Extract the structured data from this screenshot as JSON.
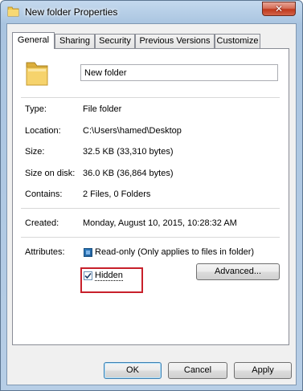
{
  "window": {
    "title": "New folder Properties",
    "close_glyph": "✕"
  },
  "tabs": [
    {
      "label": "General",
      "active": true
    },
    {
      "label": "Sharing",
      "active": false
    },
    {
      "label": "Security",
      "active": false
    },
    {
      "label": "Previous Versions",
      "active": false
    },
    {
      "label": "Customize",
      "active": false
    }
  ],
  "general": {
    "name_value": "New folder",
    "type_label": "Type:",
    "type_value": "File folder",
    "location_label": "Location:",
    "location_value": "C:\\Users\\hamed\\Desktop",
    "size_label": "Size:",
    "size_value": "32.5 KB (33,310 bytes)",
    "size_on_disk_label": "Size on disk:",
    "size_on_disk_value": "36.0 KB (36,864 bytes)",
    "contains_label": "Contains:",
    "contains_value": "2 Files, 0 Folders",
    "created_label": "Created:",
    "created_value": "Monday, August 10, 2015, 10:28:32 AM",
    "attributes_label": "Attributes:",
    "readonly_label": "Read-only (Only applies to files in folder)",
    "readonly_state": "indeterminate",
    "hidden_label": "Hidden",
    "hidden_checked": true,
    "advanced_label": "Advanced..."
  },
  "buttons": {
    "ok": "OK",
    "cancel": "Cancel",
    "apply": "Apply"
  },
  "colors": {
    "highlight": "#c8202b",
    "folder": "#f2c94c"
  },
  "icons": {
    "title": "folder-icon",
    "close": "close-icon",
    "folder": "folder-icon",
    "check": "checkmark-icon"
  }
}
